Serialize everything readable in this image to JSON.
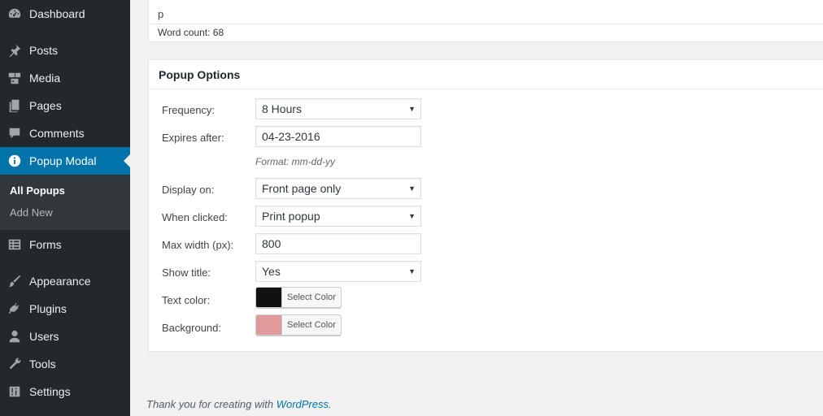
{
  "sidebar": {
    "items": [
      {
        "label": "Dashboard",
        "icon": "dashboard-icon"
      },
      {
        "label": "Posts",
        "icon": "pin-icon"
      },
      {
        "label": "Media",
        "icon": "media-icon"
      },
      {
        "label": "Pages",
        "icon": "pages-icon"
      },
      {
        "label": "Comments",
        "icon": "comment-icon"
      },
      {
        "label": "Popup Modal",
        "icon": "info-icon"
      },
      {
        "label": "Forms",
        "icon": "forms-icon"
      },
      {
        "label": "Appearance",
        "icon": "brush-icon"
      },
      {
        "label": "Plugins",
        "icon": "plug-icon"
      },
      {
        "label": "Users",
        "icon": "user-icon"
      },
      {
        "label": "Tools",
        "icon": "wrench-icon"
      },
      {
        "label": "Settings",
        "icon": "sliders-icon"
      }
    ],
    "submenu": [
      {
        "label": "All Popups"
      },
      {
        "label": "Add New"
      }
    ]
  },
  "editor": {
    "path": "p",
    "word_count": "Word count: 68"
  },
  "options": {
    "title": "Popup Options",
    "frequency": {
      "label": "Frequency:",
      "value": "8 Hours"
    },
    "expires": {
      "label": "Expires after:",
      "value": "04-23-2016",
      "hint": "Format: mm-dd-yy"
    },
    "display_on": {
      "label": "Display on:",
      "value": "Front page only"
    },
    "when_clicked": {
      "label": "When clicked:",
      "value": "Print popup"
    },
    "max_width": {
      "label": "Max width (px):",
      "value": "800"
    },
    "show_title": {
      "label": "Show title:",
      "value": "Yes"
    },
    "text_color": {
      "label": "Text color:",
      "button": "Select Color",
      "color": "#111111"
    },
    "background": {
      "label": "Background:",
      "button": "Select Color",
      "color": "#e09a9c"
    }
  },
  "footer": {
    "text": "Thank you for creating with ",
    "link": "WordPress",
    "suffix": "."
  },
  "colors": {
    "sidebar_bg": "#23282d",
    "accent": "#0073aa"
  }
}
